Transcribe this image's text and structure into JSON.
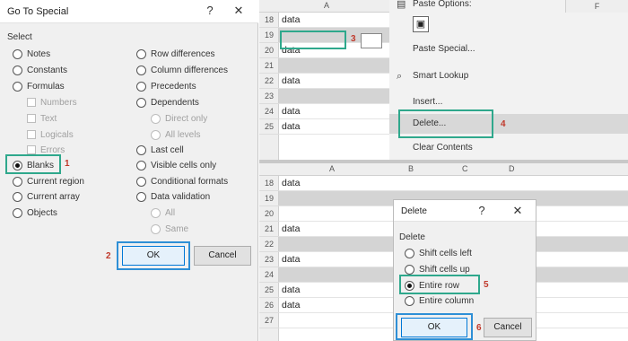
{
  "goto_dialog": {
    "title": "Go To Special",
    "help_glyph": "?",
    "close_glyph": "✕",
    "select_label": "Select",
    "left_options": [
      {
        "label": "Notes",
        "selected": false
      },
      {
        "label": "Constants",
        "selected": false
      },
      {
        "label": "Formulas",
        "selected": false
      },
      {
        "label": "Numbers",
        "sub": true
      },
      {
        "label": "Text",
        "sub": true
      },
      {
        "label": "Logicals",
        "sub": true
      },
      {
        "label": "Errors",
        "sub": true
      },
      {
        "label": "Blanks",
        "selected": true
      },
      {
        "label": "Current region",
        "selected": false
      },
      {
        "label": "Current array",
        "selected": false
      },
      {
        "label": "Objects",
        "selected": false
      }
    ],
    "right_options": [
      {
        "label": "Row differences",
        "type": "radio"
      },
      {
        "label": "Column differences",
        "type": "radio"
      },
      {
        "label": "Precedents",
        "type": "radio"
      },
      {
        "label": "Dependents",
        "type": "radio"
      },
      {
        "label": "Direct only",
        "type": "sub-radio"
      },
      {
        "label": "All levels",
        "type": "sub-radio"
      },
      {
        "label": "Last cell",
        "type": "radio"
      },
      {
        "label": "Visible cells only",
        "type": "radio"
      },
      {
        "label": "Conditional formats",
        "type": "radio"
      },
      {
        "label": "Data validation",
        "type": "radio"
      },
      {
        "label": "All",
        "type": "sub-radio"
      },
      {
        "label": "Same",
        "type": "sub-radio"
      }
    ],
    "step_blanks": "1",
    "step_ok": "2",
    "ok_label": "OK",
    "cancel_label": "Cancel"
  },
  "sheet_top": {
    "col_header": "A",
    "rows": [
      {
        "num": "18",
        "text": "data",
        "selected": false
      },
      {
        "num": "19",
        "text": "",
        "selected": true
      },
      {
        "num": "20",
        "text": "data",
        "selected": false
      },
      {
        "num": "21",
        "text": "",
        "selected": true
      },
      {
        "num": "22",
        "text": "data",
        "selected": false
      },
      {
        "num": "23",
        "text": "",
        "selected": true
      },
      {
        "num": "24",
        "text": "data",
        "selected": false
      },
      {
        "num": "25",
        "text": "data",
        "selected": false
      }
    ],
    "step_cell": "3"
  },
  "context_menu": {
    "items": [
      {
        "label": "Paste Options:",
        "icon": "clipboard-icon"
      },
      {
        "label": "",
        "icon": "paste-icon"
      },
      {
        "label": "Paste Special...",
        "icon": ""
      },
      {
        "label": "Smart Lookup",
        "icon": "search-icon"
      },
      {
        "label": "Insert...",
        "icon": ""
      },
      {
        "label": "Delete...",
        "icon": ""
      },
      {
        "label": "Clear Contents",
        "icon": ""
      }
    ],
    "step_delete": "4",
    "col_letter": "F"
  },
  "sheet_bottom": {
    "col_headers": [
      "A",
      "B",
      "C",
      "D"
    ],
    "rows": [
      {
        "num": "18",
        "text": "data",
        "selected": false
      },
      {
        "num": "19",
        "text": "",
        "selected": true
      },
      {
        "num": "20",
        "text": "",
        "selected": false
      },
      {
        "num": "21",
        "text": "data",
        "selected": false
      },
      {
        "num": "22",
        "text": "",
        "selected": true
      },
      {
        "num": "23",
        "text": "data",
        "selected": false
      },
      {
        "num": "24",
        "text": "",
        "selected": true
      },
      {
        "num": "25",
        "text": "data",
        "selected": false
      },
      {
        "num": "26",
        "text": "data",
        "selected": false
      },
      {
        "num": "27",
        "text": "",
        "selected": false
      }
    ]
  },
  "delete_dialog": {
    "title": "Delete",
    "help_glyph": "?",
    "close_glyph": "✕",
    "group_label": "Delete",
    "options": [
      {
        "label": "Shift cells left",
        "selected": false
      },
      {
        "label": "Shift cells up",
        "selected": false
      },
      {
        "label": "Entire row",
        "selected": true
      },
      {
        "label": "Entire column",
        "selected": false
      }
    ],
    "step_row": "5",
    "step_ok": "6",
    "ok_label": "OK",
    "cancel_label": "Cancel"
  },
  "colors": {
    "highlight_green": "#2fa88c",
    "highlight_blue": "#2e8fd6",
    "step_red": "#c0392b"
  }
}
